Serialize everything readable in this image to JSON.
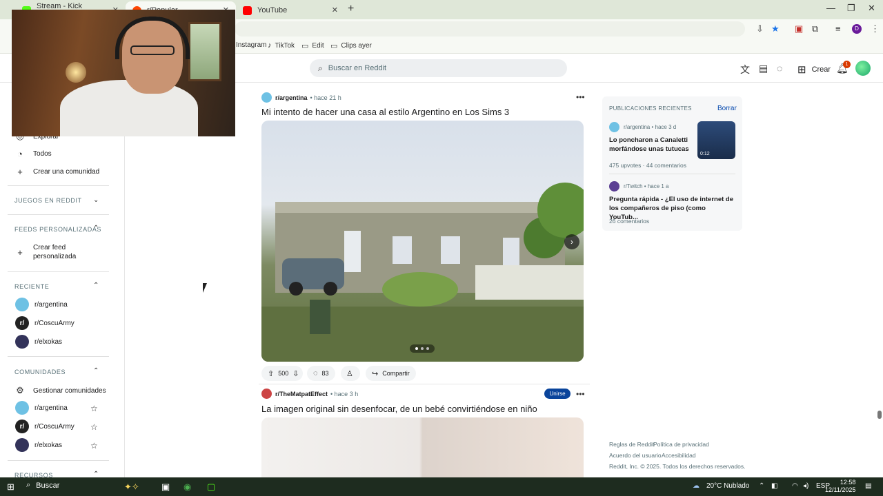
{
  "browser": {
    "tabs": [
      {
        "title": "Stream - Kick Dashboard",
        "color": "#53fc18"
      },
      {
        "title": "r/Popular",
        "color": "#ff4500"
      },
      {
        "title": "YouTube",
        "color": "#ff0000"
      }
    ],
    "new_tab": "+",
    "window_controls": [
      "—",
      "❐",
      "✕"
    ],
    "bookmarks": [
      {
        "label": "Instagram",
        "icon": "instagram-icon"
      },
      {
        "label": "TikTok",
        "icon": "tiktok-icon"
      },
      {
        "label": "Edit",
        "icon": "folder-icon"
      },
      {
        "label": "Clips ayer",
        "icon": "folder-icon"
      }
    ]
  },
  "header": {
    "search_placeholder": "Buscar en Reddit",
    "create_label": "Crear",
    "notifications_count": "1"
  },
  "sidebar": {
    "top_items": [
      {
        "label": "Explorar",
        "icon": "compass-icon"
      },
      {
        "label": "Todos",
        "icon": "all-icon"
      },
      {
        "label": "Crear una comunidad",
        "icon": "plus-icon"
      }
    ],
    "sections": {
      "games": "JUEGOS EN REDDIT",
      "custom_feeds": "FEEDS PERSONALIZADAS",
      "recent": "RECIENTE",
      "communities": "COMUNIDADES",
      "resources": "RECURSOS"
    },
    "create_feed": "Crear feed personalizada",
    "recent": [
      "r/argentina",
      "r/CoscuArmy",
      "r/elxokas"
    ],
    "manage_communities": "Gestionar comunidades",
    "communities": [
      "r/argentina",
      "r/CoscuArmy",
      "r/elxokas"
    ]
  },
  "feed": {
    "post1": {
      "subreddit": "r/argentina",
      "time": "hace 21 h",
      "title": "Mi intento de hacer una casa al estilo Argentino en Los Sims 3",
      "upvotes": "500",
      "comments": "83",
      "share_label": "Compartir"
    },
    "post2": {
      "subreddit": "r/TheMatpatEffect",
      "time": "hace 3 h",
      "title": "La imagen original sin desenfocar, de un bebé convirtiéndose en niño",
      "join_label": "Unirse"
    }
  },
  "recent_posts": {
    "title": "PUBLICACIONES RECIENTES",
    "clear_label": "Borrar",
    "items": [
      {
        "subreddit": "r/argentina",
        "time": "hace 3 d",
        "text": "Lo poncharon a Canaletti morfándose unas tutucas",
        "stats": "475 upvotes · 44 comentarios",
        "duration": "0:12"
      },
      {
        "subreddit": "r/Twitch",
        "time": "hace 1 a",
        "text": "Pregunta rápida - ¿El uso de internet de los compañeros de piso (como YouTub...",
        "stats": "26 comentarios"
      }
    ]
  },
  "footer": {
    "links": [
      "Reglas de Reddit",
      "Política de privacidad",
      "Acuerdo del usuario",
      "Accesibilidad"
    ],
    "copyright": "Reddit, Inc. © 2025. Todos los derechos reservados."
  },
  "taskbar": {
    "search_label": "Buscar",
    "weather": "20°C Nublado",
    "lang": "ESP",
    "time": "12:58",
    "date": "12/11/2025"
  }
}
